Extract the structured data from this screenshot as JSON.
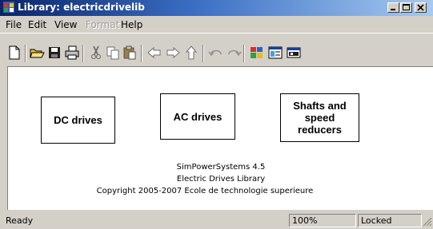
{
  "window": {
    "title": "Library: electricdrivelib",
    "app_icon": "simulink-library-icon"
  },
  "caption_buttons": [
    "minimize-icon",
    "maximize-icon",
    "close-icon"
  ],
  "menu": {
    "items": [
      {
        "label": "File",
        "enabled": true
      },
      {
        "label": "Edit",
        "enabled": true
      },
      {
        "label": "View",
        "enabled": true
      },
      {
        "label": "Format",
        "enabled": false
      },
      {
        "label": "Help",
        "enabled": true
      }
    ]
  },
  "toolbar": {
    "buttons": [
      "new-icon",
      "open-icon",
      "save-icon",
      "print-icon",
      "cut-icon",
      "copy-icon",
      "paste-icon",
      "back-icon",
      "forward-icon",
      "up-icon",
      "undo-icon",
      "redo-icon",
      "library-browser-icon",
      "model-explorer-icon",
      "debugger-icon"
    ]
  },
  "blocks": [
    {
      "label": "DC drives"
    },
    {
      "label": "AC drives"
    },
    {
      "label": "Shafts and\nspeed\nreducers"
    }
  ],
  "info": {
    "line1": "SimPowerSystems 4.5",
    "line2": "Electric Drives Library",
    "line3": "Copyright  2005-2007 Ecole de technologie superieure"
  },
  "status": {
    "text": "Ready",
    "zoom": "100%",
    "lock_state": "Locked"
  },
  "colors": {
    "titlebar_start": "#0a246a",
    "titlebar_end": "#a6caf0",
    "face": "#d4d0c8",
    "canvas": "#ffffff"
  }
}
